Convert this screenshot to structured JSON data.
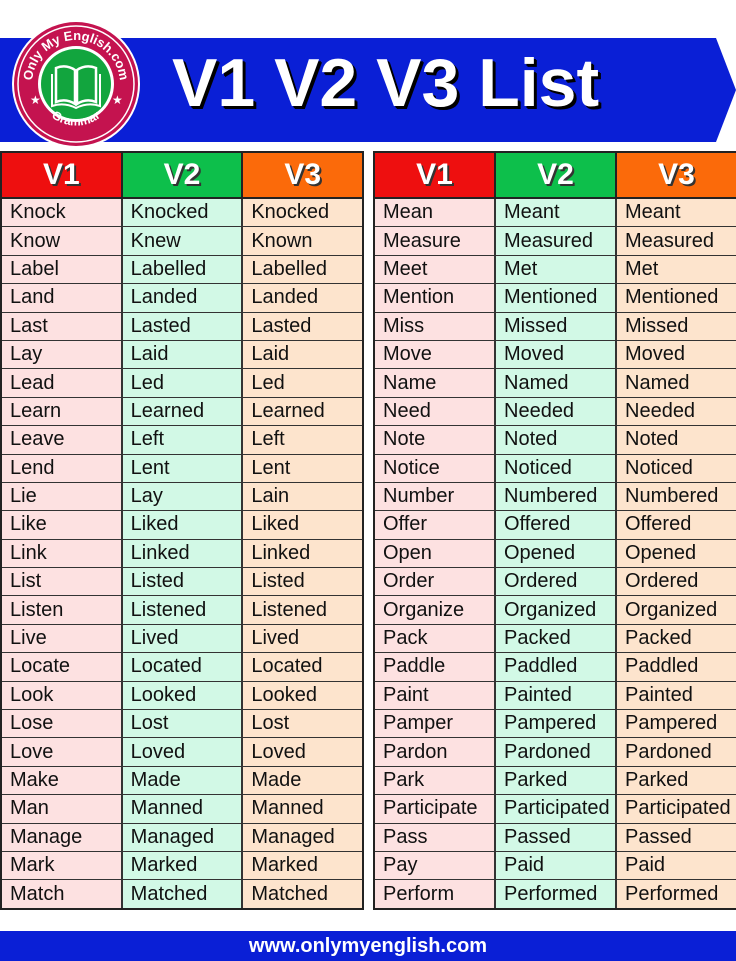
{
  "header": {
    "title": "V1 V2 V3 List",
    "logo": {
      "top_text": "Only My English.com",
      "bottom_text": "Grammar",
      "icon": "open-book-icon"
    }
  },
  "colors": {
    "banner_blue": "#0a1fd6",
    "v1_header": "#ee0f0f",
    "v2_header": "#0dbf4b",
    "v3_header": "#fb6a0a",
    "v1_cell": "#fde1e1",
    "v2_cell": "#d2f9e6",
    "v3_cell": "#fde4cd",
    "logo_ring": "#c4134f",
    "logo_center": "#12a53e"
  },
  "tables": {
    "left": {
      "headers": [
        "V1",
        "V2",
        "V3"
      ],
      "rows": [
        [
          "Knock",
          "Knocked",
          "Knocked"
        ],
        [
          "Know",
          "Knew",
          "Known"
        ],
        [
          "Label",
          "Labelled",
          "Labelled"
        ],
        [
          "Land",
          "Landed",
          "Landed"
        ],
        [
          "Last",
          "Lasted",
          "Lasted"
        ],
        [
          "Lay",
          "Laid",
          "Laid"
        ],
        [
          "Lead",
          "Led",
          "Led"
        ],
        [
          "Learn",
          "Learned",
          "Learned"
        ],
        [
          "Leave",
          "Left",
          "Left"
        ],
        [
          "Lend",
          "Lent",
          "Lent"
        ],
        [
          "Lie",
          "Lay",
          "Lain"
        ],
        [
          "Like",
          "Liked",
          "Liked"
        ],
        [
          "Link",
          "Linked",
          "Linked"
        ],
        [
          "List",
          "Listed",
          "Listed"
        ],
        [
          "Listen",
          "Listened",
          "Listened"
        ],
        [
          "Live",
          "Lived",
          "Lived"
        ],
        [
          "Locate",
          "Located",
          "Located"
        ],
        [
          "Look",
          "Looked",
          "Looked"
        ],
        [
          "Lose",
          "Lost",
          "Lost"
        ],
        [
          "Love",
          "Loved",
          "Loved"
        ],
        [
          "Make",
          "Made",
          "Made"
        ],
        [
          "Man",
          "Manned",
          "Manned"
        ],
        [
          "Manage",
          "Managed",
          "Managed"
        ],
        [
          "Mark",
          "Marked",
          "Marked"
        ],
        [
          "Match",
          "Matched",
          "Matched"
        ]
      ]
    },
    "right": {
      "headers": [
        "V1",
        "V2",
        "V3"
      ],
      "rows": [
        [
          "Mean",
          "Meant",
          "Meant"
        ],
        [
          "Measure",
          "Measured",
          "Measured"
        ],
        [
          "Meet",
          "Met",
          "Met"
        ],
        [
          "Mention",
          "Mentioned",
          "Mentioned"
        ],
        [
          "Miss",
          "Missed",
          "Missed"
        ],
        [
          "Move",
          "Moved",
          "Moved"
        ],
        [
          "Name",
          "Named",
          "Named"
        ],
        [
          "Need",
          "Needed",
          "Needed"
        ],
        [
          "Note",
          "Noted",
          "Noted"
        ],
        [
          "Notice",
          "Noticed",
          "Noticed"
        ],
        [
          "Number",
          "Numbered",
          "Numbered"
        ],
        [
          "Offer",
          "Offered",
          "Offered"
        ],
        [
          "Open",
          "Opened",
          "Opened"
        ],
        [
          "Order",
          "Ordered",
          "Ordered"
        ],
        [
          "Organize",
          "Organized",
          "Organized"
        ],
        [
          "Pack",
          "Packed",
          "Packed"
        ],
        [
          "Paddle",
          "Paddled",
          "Paddled"
        ],
        [
          "Paint",
          "Painted",
          "Painted"
        ],
        [
          "Pamper",
          "Pampered",
          "Pampered"
        ],
        [
          "Pardon",
          "Pardoned",
          "Pardoned"
        ],
        [
          "Park",
          "Parked",
          "Parked"
        ],
        [
          "Participate",
          "Participated",
          "Participated"
        ],
        [
          "Pass",
          "Passed",
          "Passed"
        ],
        [
          "Pay",
          "Paid",
          "Paid"
        ],
        [
          "Perform",
          "Performed",
          "Performed"
        ]
      ]
    }
  },
  "footer": {
    "url_text": "www.onlymyenglish.com"
  }
}
